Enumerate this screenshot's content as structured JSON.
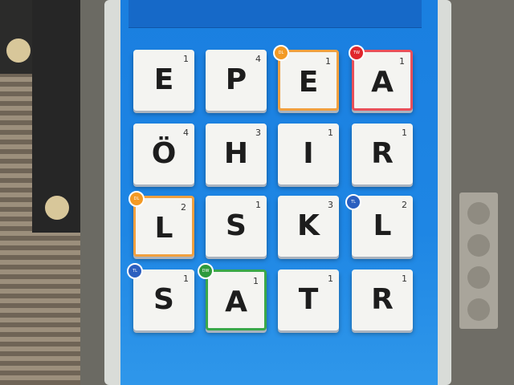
{
  "board": {
    "tiles": [
      {
        "letter": "E",
        "points": "1",
        "bonus": ""
      },
      {
        "letter": "P",
        "points": "4",
        "bonus": ""
      },
      {
        "letter": "E",
        "points": "1",
        "bonus": "DL"
      },
      {
        "letter": "A",
        "points": "1",
        "bonus": "TW"
      },
      {
        "letter": "Ö",
        "points": "4",
        "bonus": ""
      },
      {
        "letter": "H",
        "points": "3",
        "bonus": ""
      },
      {
        "letter": "I",
        "points": "1",
        "bonus": ""
      },
      {
        "letter": "R",
        "points": "1",
        "bonus": ""
      },
      {
        "letter": "L",
        "points": "2",
        "bonus": "DL"
      },
      {
        "letter": "S",
        "points": "1",
        "bonus": ""
      },
      {
        "letter": "K",
        "points": "3",
        "bonus": ""
      },
      {
        "letter": "L",
        "points": "2",
        "bonus": "TL"
      },
      {
        "letter": "S",
        "points": "1",
        "bonus": "TL"
      },
      {
        "letter": "A",
        "points": "1",
        "bonus": "DW"
      },
      {
        "letter": "T",
        "points": "1",
        "bonus": ""
      },
      {
        "letter": "R",
        "points": "1",
        "bonus": ""
      }
    ]
  },
  "colors": {
    "screen_blue": "#1e86e4",
    "dl_orange": "#f39a24",
    "tw_red": "#e0262c",
    "tl_blue": "#2b5fbf",
    "dw_green": "#2e9a3c"
  }
}
